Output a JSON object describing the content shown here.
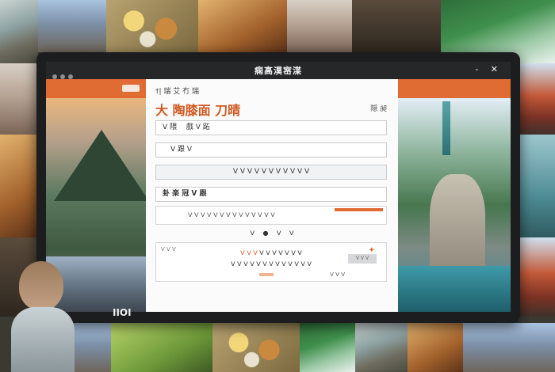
{
  "window": {
    "title": "痫高漠宻渫"
  },
  "main": {
    "breadcrumb": "†| 瑞 艾 冇 瑞 ",
    "heading": "大 陶膝面 刀晴",
    "edit_label": "隠 昶",
    "rows": [
      "ᐯ 隈　 戲 ᐯ 跖",
      "ᐯ 跟 ᐯ",
      "ᐯ ᐯ  ᐯ ᐯ ᐯ  ᐯ ᐯ  ᐯ ᐯ ᐯ ᐯ",
      "卦 楽 冠 ᐯ 跟"
    ],
    "progress": {
      "label": "ᐯ ᐯ ᐯ ᐯ ᐯ ᐯ  ᐯ ᐯ ᐯ ᐯ ᐯ ᐯ ᐯ ᐯ",
      "value": 0.21
    },
    "pager": [
      "ᐯ",
      "●",
      "ᐯ",
      "ᐯ"
    ],
    "card": {
      "tl": "ᐯ ᐯ ᐯ",
      "line1_a": "ᐯ ᐯ ᐯ",
      "line1_b": "ᐯ ᐯ ᐯ ᐯ ᐯ ᐯ ᐯ",
      "line2": "ᐯ ᐯ ᐯ ᐯ ᐯ ᐯ ᐯ ᐯ ᐯ ᐯ ᐯ ᐯ ᐯ",
      "button": "ᐯ ᐯ ᐯ",
      "mini": "ᐯ ᐯ ᐯ"
    }
  },
  "bottom_caption": "IIOI"
}
